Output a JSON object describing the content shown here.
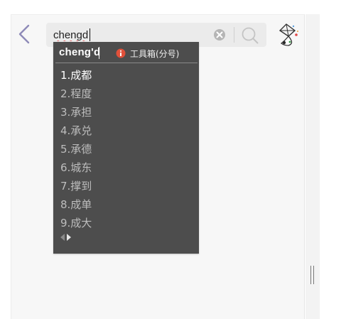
{
  "search": {
    "value": "chengd"
  },
  "ime": {
    "composition": "cheng'd",
    "toolbox_label": "工具箱(分号)",
    "candidates": [
      {
        "label": "1.成都",
        "selected": true
      },
      {
        "label": "2.程度",
        "selected": false
      },
      {
        "label": "3.承担",
        "selected": false
      },
      {
        "label": "4.承兑",
        "selected": false
      },
      {
        "label": "5.承德",
        "selected": false
      },
      {
        "label": "6.城东",
        "selected": false
      },
      {
        "label": "7.撑到",
        "selected": false
      },
      {
        "label": "8.成单",
        "selected": false
      },
      {
        "label": "9.成大",
        "selected": false
      }
    ]
  },
  "colors": {
    "ime_background": "#4d4d4d",
    "toolbox_icon": "#e0503a",
    "back_arrow": "#8e8ab8"
  },
  "icons": {
    "back": "chevron-left-icon",
    "clear": "clear-x-icon",
    "search": "search-icon",
    "avatar": "kite-avatar-icon",
    "toolbox": "info-icon",
    "pager_prev": "triangle-left-icon",
    "pager_next": "triangle-right-icon"
  }
}
